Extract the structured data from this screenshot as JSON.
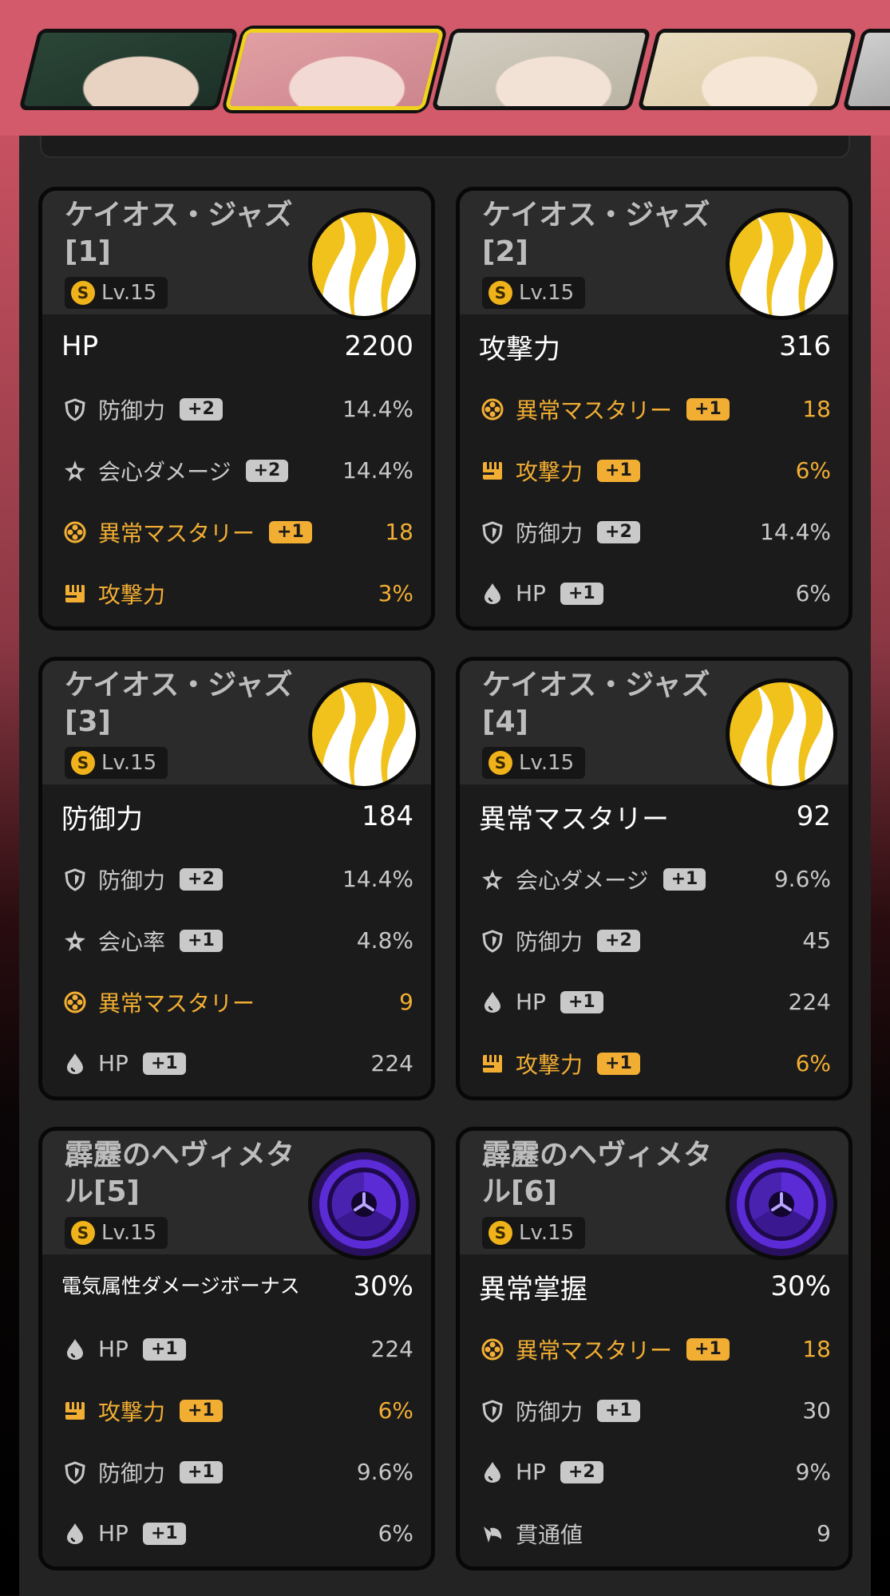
{
  "characters": [
    {
      "name": "character-1",
      "active": false,
      "palette": [
        "#2d4a3a",
        "#1a2c24",
        "#e8d2c2"
      ]
    },
    {
      "name": "character-2",
      "active": true,
      "palette": [
        "#e4a4a8",
        "#c98189",
        "#f3d9d3"
      ]
    },
    {
      "name": "character-3",
      "active": false,
      "palette": [
        "#d6d2c6",
        "#b7b0a0",
        "#f2e2d6"
      ]
    },
    {
      "name": "character-4",
      "active": false,
      "palette": [
        "#ece0c4",
        "#d6c49e",
        "#f6e6d6"
      ]
    },
    {
      "name": "character-5",
      "active": false,
      "palette": [
        "#d9d9d9",
        "#8c8c8c",
        "#f0e6e0"
      ]
    }
  ],
  "colors": {
    "highlight": "#f2ae33",
    "normal": "#c8c8c8",
    "jazz_disc": "#f1c21b",
    "metal_disc": "#5b2bd6"
  },
  "discs": [
    {
      "name": "ケイオス・ジャズ[1]",
      "level": "Lv.15",
      "art": "jazz",
      "main": {
        "label": "HP",
        "value": "2200",
        "small": false
      },
      "subs": [
        {
          "icon": "shield-icon",
          "label": "防御力",
          "roll": "+2",
          "value": "14.4%",
          "hl": false
        },
        {
          "icon": "crit-dmg-icon",
          "label": "会心ダメージ",
          "roll": "+2",
          "value": "14.4%",
          "hl": false
        },
        {
          "icon": "anomaly-icon",
          "label": "異常マスタリー",
          "roll": "+1",
          "value": "18",
          "hl": true
        },
        {
          "icon": "attack-icon",
          "label": "攻撃力",
          "roll": "",
          "value": "3%",
          "hl": true
        }
      ]
    },
    {
      "name": "ケイオス・ジャズ[2]",
      "level": "Lv.15",
      "art": "jazz",
      "main": {
        "label": "攻撃力",
        "value": "316",
        "small": false
      },
      "subs": [
        {
          "icon": "anomaly-icon",
          "label": "異常マスタリー",
          "roll": "+1",
          "value": "18",
          "hl": true
        },
        {
          "icon": "attack-icon",
          "label": "攻撃力",
          "roll": "+1",
          "value": "6%",
          "hl": true
        },
        {
          "icon": "shield-icon",
          "label": "防御力",
          "roll": "+2",
          "value": "14.4%",
          "hl": false
        },
        {
          "icon": "hp-drop-icon",
          "label": "HP",
          "roll": "+1",
          "value": "6%",
          "hl": false
        }
      ]
    },
    {
      "name": "ケイオス・ジャズ[3]",
      "level": "Lv.15",
      "art": "jazz",
      "main": {
        "label": "防御力",
        "value": "184",
        "small": false
      },
      "subs": [
        {
          "icon": "shield-icon",
          "label": "防御力",
          "roll": "+2",
          "value": "14.4%",
          "hl": false
        },
        {
          "icon": "crit-rate-icon",
          "label": "会心率",
          "roll": "+1",
          "value": "4.8%",
          "hl": false
        },
        {
          "icon": "anomaly-icon",
          "label": "異常マスタリー",
          "roll": "",
          "value": "9",
          "hl": true
        },
        {
          "icon": "hp-drop-icon",
          "label": "HP",
          "roll": "+1",
          "value": "224",
          "hl": false
        }
      ]
    },
    {
      "name": "ケイオス・ジャズ[4]",
      "level": "Lv.15",
      "art": "jazz",
      "main": {
        "label": "異常マスタリー",
        "value": "92",
        "small": false
      },
      "subs": [
        {
          "icon": "crit-dmg-icon",
          "label": "会心ダメージ",
          "roll": "+1",
          "value": "9.6%",
          "hl": false
        },
        {
          "icon": "shield-icon",
          "label": "防御力",
          "roll": "+2",
          "value": "45",
          "hl": false
        },
        {
          "icon": "hp-drop-icon",
          "label": "HP",
          "roll": "+1",
          "value": "224",
          "hl": false
        },
        {
          "icon": "attack-icon",
          "label": "攻撃力",
          "roll": "+1",
          "value": "6%",
          "hl": true
        }
      ]
    },
    {
      "name": "霹靂のヘヴィメタル[5]",
      "level": "Lv.15",
      "art": "metal",
      "main": {
        "label": "電気属性ダメージボーナス",
        "value": "30%",
        "small": true
      },
      "subs": [
        {
          "icon": "hp-drop-icon",
          "label": "HP",
          "roll": "+1",
          "value": "224",
          "hl": false
        },
        {
          "icon": "attack-icon",
          "label": "攻撃力",
          "roll": "+1",
          "value": "6%",
          "hl": true
        },
        {
          "icon": "shield-icon",
          "label": "防御力",
          "roll": "+1",
          "value": "9.6%",
          "hl": false
        },
        {
          "icon": "hp-drop-icon",
          "label": "HP",
          "roll": "+1",
          "value": "6%",
          "hl": false
        }
      ]
    },
    {
      "name": "霹靂のヘヴィメタル[6]",
      "level": "Lv.15",
      "art": "metal",
      "main": {
        "label": "異常掌握",
        "value": "30%",
        "small": false
      },
      "subs": [
        {
          "icon": "anomaly-icon",
          "label": "異常マスタリー",
          "roll": "+1",
          "value": "18",
          "hl": true
        },
        {
          "icon": "shield-icon",
          "label": "防御力",
          "roll": "+1",
          "value": "30",
          "hl": false
        },
        {
          "icon": "hp-drop-icon",
          "label": "HP",
          "roll": "+2",
          "value": "9%",
          "hl": false
        },
        {
          "icon": "pen-icon",
          "label": "貫通値",
          "roll": "",
          "value": "9",
          "hl": false
        }
      ]
    }
  ]
}
